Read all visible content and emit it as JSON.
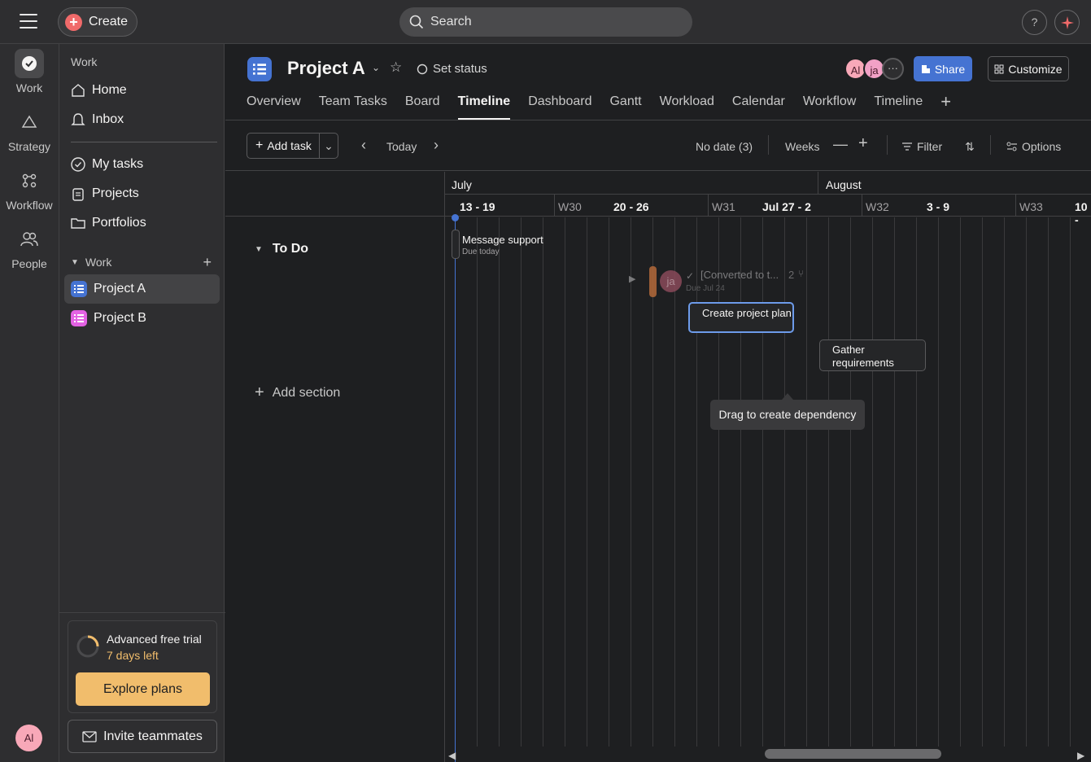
{
  "topbar": {
    "create_label": "Create",
    "search_placeholder": "Search",
    "help_label": "?"
  },
  "rail": {
    "items": [
      {
        "label": "Work",
        "icon": "check-circle-icon"
      },
      {
        "label": "Strategy",
        "icon": "triangle-icon"
      },
      {
        "label": "Workflow",
        "icon": "workflow-icon"
      },
      {
        "label": "People",
        "icon": "people-icon"
      }
    ],
    "avatar_initials": "Al"
  },
  "sidebar": {
    "heading": "Work",
    "items": [
      {
        "label": "Home",
        "icon": "home-icon"
      },
      {
        "label": "Inbox",
        "icon": "bell-icon"
      },
      {
        "label": "My tasks",
        "icon": "check-circle-icon"
      },
      {
        "label": "Projects",
        "icon": "clipboard-icon"
      },
      {
        "label": "Portfolios",
        "icon": "folder-icon"
      }
    ],
    "section_label": "Work",
    "projects": [
      {
        "label": "Project A",
        "color": "#4573d2",
        "active": true
      },
      {
        "label": "Project B",
        "color": "#e362e3",
        "active": false
      }
    ],
    "trial_title": "Advanced free trial",
    "trial_days": "7 days left",
    "explore_label": "Explore plans",
    "invite_label": "Invite teammates"
  },
  "header": {
    "project_title": "Project A",
    "set_status": "Set status",
    "avatars": [
      "Al",
      "ja"
    ],
    "share_label": "Share",
    "customize_label": "Customize",
    "tabs": [
      "Overview",
      "Team Tasks",
      "Board",
      "Timeline",
      "Dashboard",
      "Gantt",
      "Workload",
      "Calendar",
      "Workflow",
      "Timeline"
    ],
    "active_tab": "Timeline"
  },
  "toolbar": {
    "add_task": "Add task",
    "today": "Today",
    "no_date": "No date (3)",
    "weeks": "Weeks",
    "filter": "Filter",
    "options": "Options"
  },
  "left_pane": {
    "section_name": "To Do",
    "add_section": "Add section"
  },
  "timeline": {
    "months": [
      "July",
      "August"
    ],
    "weeks": [
      "13 - 19",
      "W30",
      "20 - 26",
      "W31",
      "Jul 27 - 2",
      "W32",
      "3 - 9",
      "W33",
      "10 -"
    ],
    "tasks": [
      {
        "title": "Message support",
        "due": "Due today"
      },
      {
        "title": "[Converted to t...",
        "due": "Due Jul 24",
        "subtask_count": "2",
        "assignee": "ja"
      },
      {
        "title": "Create project plan"
      },
      {
        "title": "Gather requirements"
      }
    ],
    "tooltip": "Drag to create dependency"
  },
  "colors": {
    "accent": "#4573d2",
    "create": "#f06a6a",
    "trial": "#f1bd6c",
    "background": "#1e1f21"
  }
}
